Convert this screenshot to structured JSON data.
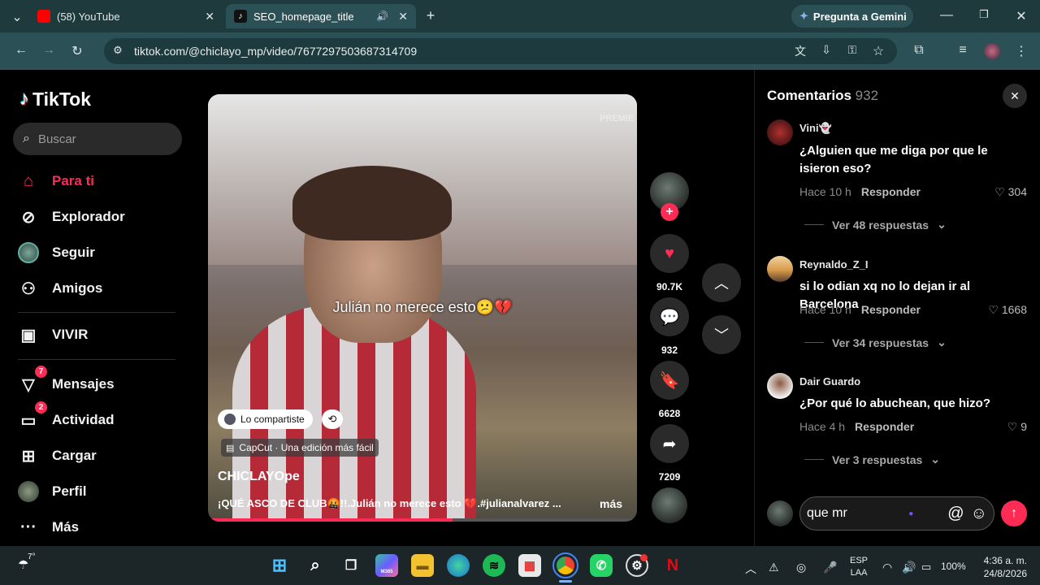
{
  "browser": {
    "tabs": [
      {
        "label": "(58) YouTube"
      },
      {
        "label": "SEO_homepage_title"
      }
    ],
    "url": "tiktok.com/@chiclayo_mp/video/7677297503687314709",
    "gemini_label": "Pregunta a Gemini"
  },
  "sidebar": {
    "logo": "TikTok",
    "search_placeholder": "Buscar",
    "items": [
      {
        "label": "Para ti",
        "icon": "home-icon",
        "active": true
      },
      {
        "label": "Explorador",
        "icon": "compass-icon"
      },
      {
        "label": "Seguir",
        "icon": "following-avatar-icon"
      },
      {
        "label": "Amigos",
        "icon": "friends-icon"
      },
      {
        "label": "VIVIR",
        "icon": "live-icon"
      },
      {
        "label": "Mensajes",
        "icon": "messages-icon",
        "badge": "7"
      },
      {
        "label": "Actividad",
        "icon": "activity-icon",
        "badge": "2"
      },
      {
        "label": "Cargar",
        "icon": "upload-icon"
      },
      {
        "label": "Perfil",
        "icon": "profile-avatar-icon"
      },
      {
        "label": "Más",
        "icon": "more-icon"
      }
    ]
  },
  "video": {
    "caption_overlay": "Julián no merece esto😕💔",
    "watermark": "PREMIE",
    "shared_label": "Lo compartiste",
    "capcut_label": "CapCut · Una edición más fácil",
    "author": "CHICLAYOpe",
    "description": "¡QUÉ ASCO DE CLUB🤬!!.Julián no merece esto 💔.#julianalvarez ...",
    "more_label": "más",
    "progress": 0.57
  },
  "actions": {
    "likes": "90.7K",
    "comments": "932",
    "saves": "6628",
    "shares": "7209"
  },
  "comments_panel": {
    "title": "Comentarios",
    "count": "932",
    "comments": [
      {
        "user": "Vini👻",
        "text": "¿Alguien que me diga por que le isieron eso?",
        "time": "Hace 10 h",
        "reply": "Responder",
        "likes": "304",
        "replies": "Ver 48 respuestas"
      },
      {
        "user": "Reynaldo_Z_I",
        "text": "si lo odian xq no lo dejan ir al Barcelona",
        "time": "Hace 10 h",
        "reply": "Responder",
        "likes": "1668",
        "replies": "Ver 34 respuestas"
      },
      {
        "user": "Dair Guardo",
        "text": "¿Por qué lo abuchean, que hizo?",
        "time": "Hace 4 h",
        "reply": "Responder",
        "likes": "9",
        "replies": "Ver 3 respuestas"
      }
    ],
    "input_value": "que mr"
  },
  "taskbar": {
    "weather": "7°",
    "lang_top": "ESP",
    "lang_bottom": "LAA",
    "battery": "100%",
    "time": "4:36 a. m.",
    "date": "24/8/2026",
    "copilot_label": "M365"
  }
}
